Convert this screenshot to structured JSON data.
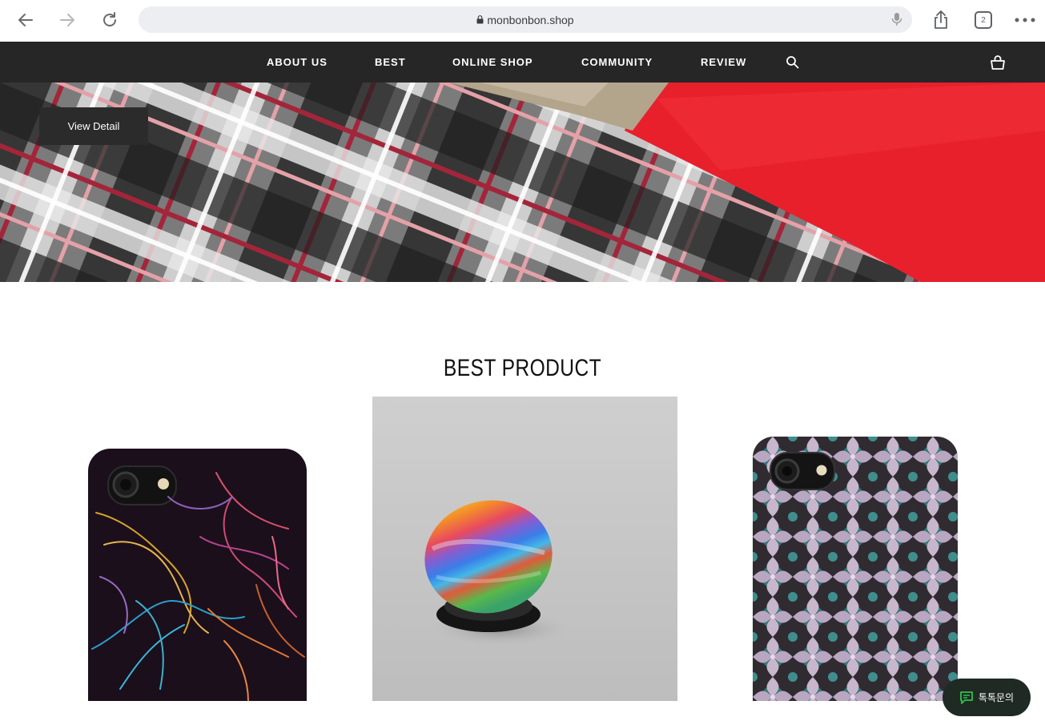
{
  "browser": {
    "url": "monbonbon.shop"
  },
  "nav": {
    "items": [
      {
        "label": "ABOUT US"
      },
      {
        "label": "BEST"
      },
      {
        "label": "ONLINE SHOP"
      },
      {
        "label": "COMMUNITY"
      },
      {
        "label": "REVIEW"
      }
    ]
  },
  "hero": {
    "button_label": "View Detail"
  },
  "best": {
    "title": "BEST PRODUCT",
    "products": [
      {
        "name": "phone-case-neon-lines"
      },
      {
        "name": "rainbow-grip"
      },
      {
        "name": "phone-case-kaleidoscope"
      }
    ]
  },
  "chat": {
    "label": "톡톡문의"
  },
  "colors": {
    "nav_bg": "#262626",
    "accent_red": "#e8202c",
    "chat_icon": "#2ec24a"
  }
}
